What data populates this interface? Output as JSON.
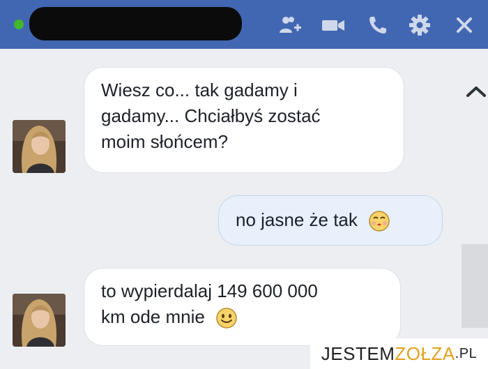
{
  "header": {
    "status_color": "#42b72a",
    "name_redacted": true,
    "icons": [
      "add-friend-icon",
      "video-call-icon",
      "phone-icon",
      "gear-icon",
      "close-icon"
    ],
    "accent": "#4267b2"
  },
  "messages": [
    {
      "direction": "in",
      "text_lines": [
        "Wiesz co... tak gadamy i",
        "gadamy... Chciałbyś zostać",
        "moim słońcem?"
      ]
    },
    {
      "direction": "out",
      "text": "no jasne że tak",
      "emoji": "kiss-emoji"
    },
    {
      "direction": "in",
      "text_lines": [
        "to wypierdalaj 149 600 000",
        "km ode mnie"
      ],
      "emoji": "smile-emoji"
    }
  ],
  "watermark": {
    "part1": "JESTEM",
    "part2": "ZOŁZA",
    "part3": ".PL"
  }
}
